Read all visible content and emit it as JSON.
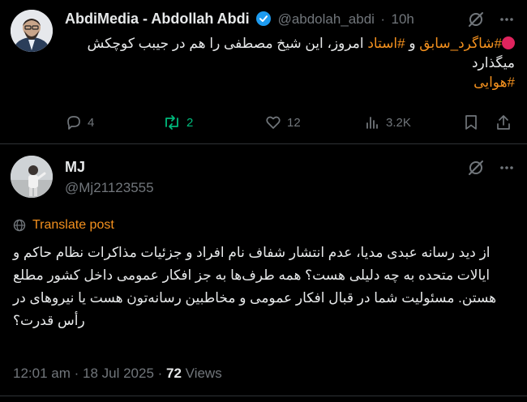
{
  "tweet1": {
    "display_name": "AbdiMedia - Abdollah Abdi",
    "handle": "@abdolah_abdi",
    "separator": "·",
    "time": "10h",
    "emoji": "red-circle",
    "line1_hashtag1": "#شاگرد_سابق",
    "line1_and": " و ",
    "line1_hashtag2": "#استاد",
    "line1_text": " امروز، این شیخ مصطفی را هم در جیبب کوچکش",
    "line2_text": "میگذارد",
    "line3_hashtag": "#هوایی",
    "actions": {
      "reply_count": "4",
      "repost_count": "2",
      "like_count": "12",
      "views_count": "3.2K"
    }
  },
  "tweet2": {
    "display_name": "MJ",
    "handle": "@Mj21123555",
    "translate_label": "Translate post",
    "body_lines": [
      "از دید رسانه عبدی مدیا، عدم انتشار شفاف نام افراد و جزئیات مذاکرات نظام حاکم و",
      "ایالات متحده به چه دلیلی هست؟ همه طرف‌ها به جز افکار عمومی داخل کشور مطلع",
      "هستن. مسئولیت شما در قبال افکار عمومی و مخاطبین رسانه‌تون هست یا نیروهای در",
      "رأس قدرت؟"
    ],
    "timestamp": "12:01 am · 18 Jul 2025 ·",
    "views_count": "72",
    "views_label": "Views"
  },
  "colors": {
    "background": "#000000",
    "text": "#e7e9ea",
    "muted": "#71767b",
    "hashtag": "#f4911e",
    "verified": "#1d9bf0",
    "repost_green": "#00ba7c",
    "translate": "#f4911e"
  }
}
